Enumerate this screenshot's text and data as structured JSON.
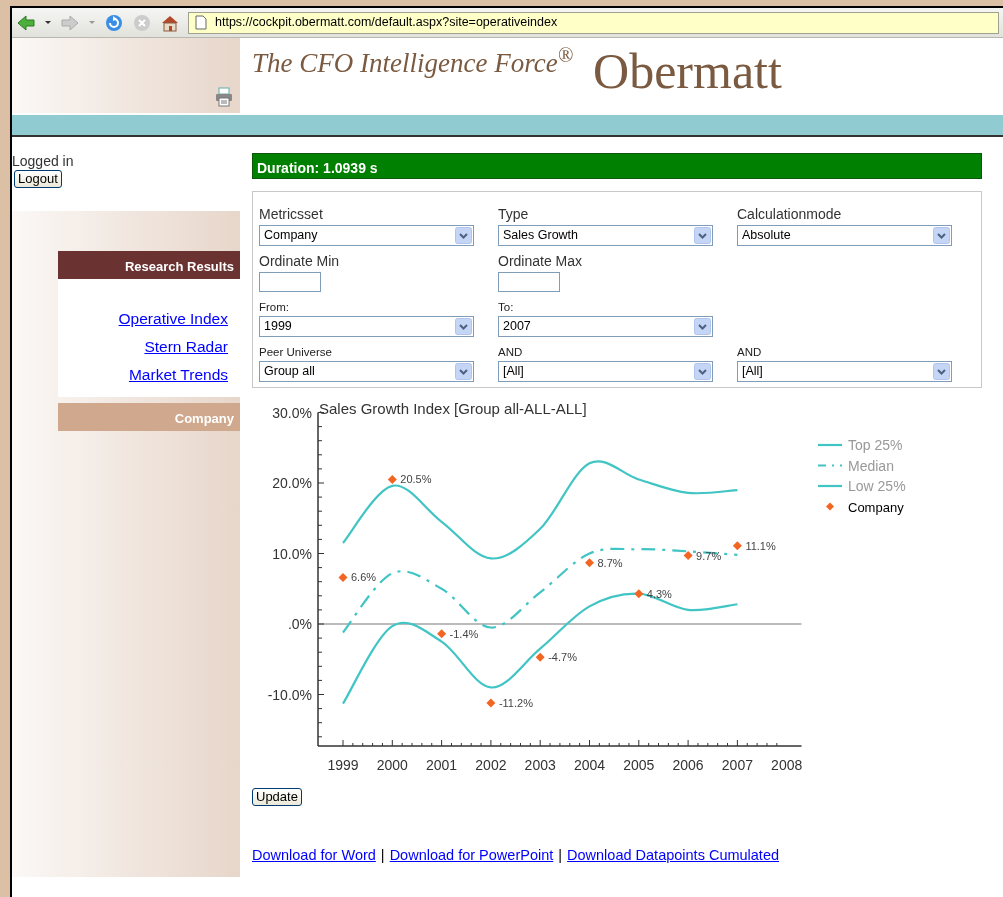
{
  "browser": {
    "url": "https://cockpit.obermatt.com/default.aspx?site=operativeindex"
  },
  "header": {
    "tagline": "The CFO Intelligence Force$^{®}$",
    "brand": "Obermatt"
  },
  "sidebar": {
    "login_status": "Logged in",
    "logout_button": "Logout",
    "sections": [
      {
        "title": "Research Results",
        "links": [
          "Operative Index",
          "Stern Radar",
          "Market Trends"
        ]
      },
      {
        "title": "Company"
      }
    ]
  },
  "duration": "Duration: 1.0939 s",
  "filters": {
    "metric_settings": [
      {
        "fields": [
          {
            "label": "Metricsset",
            "kind": "select",
            "value": "Company"
          },
          {
            "label": "Type",
            "kind": "select",
            "value": "Sales Growth"
          },
          {
            "label": "Calculationmode",
            "kind": "select",
            "value": "Absolute"
          }
        ]
      },
      {
        "fields": [
          {
            "label": "Ordinate Min",
            "kind": "text"
          },
          {
            "label": "Ordinate Max",
            "kind": "text"
          }
        ]
      }
    ],
    "period_and_peers": [
      {
        "fields": [
          {
            "label": "From:",
            "kind": "select",
            "value": "1999"
          },
          {
            "label": "To:",
            "kind": "select",
            "value": "2007"
          }
        ]
      },
      {
        "fields": [
          {
            "label": "Peer Universe",
            "kind": "select",
            "value": "Group all"
          },
          {
            "label": "AND",
            "kind": "select",
            "value": "[All]"
          },
          {
            "label": "AND",
            "kind": "select",
            "value": "[All]"
          }
        ]
      }
    ]
  },
  "chart_data": {
    "type": "line",
    "title": "Sales Growth Index [Group all-ALL-ALL]",
    "x": [
      1999,
      2000,
      2001,
      2002,
      2003,
      2004,
      2005,
      2006,
      2007
    ],
    "legend": true,
    "xlim": [
      1998.5,
      2008.3
    ],
    "ylim": [
      -17.3,
      30
    ],
    "xticks": [
      1999,
      2000,
      2001,
      2002,
      2003,
      2004,
      2005,
      2006,
      2007,
      2008
    ],
    "yticks": [
      {
        "value": 30,
        "label": "30.0%"
      },
      {
        "value": 20,
        "label": "20.0%"
      },
      {
        "value": 10,
        "label": "10.0%"
      },
      {
        "value": 0,
        "label": ".0%"
      },
      {
        "value": -10,
        "label": "-10.0%"
      }
    ],
    "series": [
      {
        "name": "Top 25%",
        "line_style": "solid",
        "color": "#40c4c4",
        "values": [
          11.5,
          19.6,
          14.5,
          9.3,
          13.5,
          22.8,
          20.5,
          18.6,
          19.0
        ]
      },
      {
        "name": "Median",
        "line_style": "dashdot",
        "color": "#40c4c4",
        "values": [
          -1.2,
          7.2,
          5.0,
          -0.5,
          4.5,
          10.0,
          10.6,
          10.3,
          9.8
        ]
      },
      {
        "name": "Low 25%",
        "line_style": "solid",
        "color": "#40c4c4",
        "values": [
          -11.3,
          -0.3,
          -2.5,
          -9.0,
          -3.5,
          2.5,
          4.3,
          2.0,
          2.8
        ]
      },
      {
        "name": "Company",
        "type": "scatter",
        "marker": "diamond",
        "color": "#f26522",
        "values": [
          6.6,
          20.5,
          -1.4,
          -11.2,
          -4.7,
          8.7,
          4.3,
          9.7,
          11.1
        ],
        "value_labels": [
          "6.6%",
          "20.5%",
          "-1.4%",
          "-11.2%",
          "-4.7%",
          "8.7%",
          "4.3%",
          "9.7%",
          "11.1%"
        ]
      }
    ]
  },
  "update_button": "Update",
  "downloads": {
    "separator": "|",
    "links": [
      "Download for Word",
      "Download for PowerPoint",
      "Download Datapoints Cumulated"
    ]
  }
}
